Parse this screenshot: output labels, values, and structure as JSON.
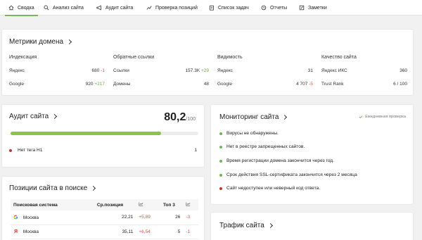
{
  "nav": {
    "tabs": [
      {
        "label": "Сводка",
        "icon": "home-icon",
        "active": true
      },
      {
        "label": "Анализ сайта",
        "icon": "search-icon"
      },
      {
        "label": "Аудит сайта",
        "icon": "megaphone-icon"
      },
      {
        "label": "Проверка позиций",
        "icon": "trend-icon"
      },
      {
        "label": "Список задач",
        "icon": "clipboard-icon"
      },
      {
        "label": "Отчеты",
        "icon": "clock-icon"
      },
      {
        "label": "Заметки",
        "icon": "edit-icon"
      }
    ]
  },
  "metrics": {
    "title": "Метрики домена",
    "columns": [
      {
        "head": "Индексация",
        "rows": [
          {
            "label": "Яндекс",
            "value": "680",
            "delta": "-1",
            "trend": "neg"
          },
          {
            "label": "Google",
            "value": "920",
            "delta": "+217",
            "trend": "pos"
          }
        ]
      },
      {
        "head": "Обратные ссылки",
        "rows": [
          {
            "label": "Ссылки",
            "value": "157.3K",
            "delta": "+29",
            "trend": "pos"
          },
          {
            "label": "Домены",
            "value": "48",
            "delta": "",
            "trend": ""
          }
        ]
      },
      {
        "head": "Видимость",
        "rows": [
          {
            "label": "Яндекс",
            "value": "31",
            "delta": "",
            "trend": ""
          },
          {
            "label": "Google",
            "value": "4 707",
            "delta": "-5",
            "trend": "neg"
          }
        ]
      },
      {
        "head": "Качество сайта",
        "rows": [
          {
            "label": "Яндекс ИКС",
            "value": "360",
            "delta": "",
            "trend": ""
          },
          {
            "label": "Trust Rank",
            "value": "6 / 100",
            "delta": "",
            "trend": ""
          }
        ]
      }
    ]
  },
  "audit": {
    "title": "Аудит сайта",
    "score": "80,2",
    "score_max": "/100",
    "progress": 0.8,
    "issues": [
      {
        "label": "Нет тега H1",
        "count": "1"
      }
    ]
  },
  "monitoring": {
    "title": "Мониторинг сайта",
    "badge": "Ежедневная проверка",
    "items": [
      "Вирусы не обнаружены.",
      "Нет в реестре запрещенных сайтов.",
      "Время регистрации домена закончится через год.",
      "Срок действия SSL-сертификата закончится через 2 месяца",
      "Сайт недоступен или неверный код ответа."
    ]
  },
  "positions": {
    "title": "Позиции сайта в поиске",
    "headers": {
      "engine": "Поисковая система",
      "avg": "Ср.позиция",
      "top": "Топ 3"
    },
    "rows": [
      {
        "engine": "google",
        "region": "Москва",
        "avg": "22,21",
        "avg_delta": "+5,89",
        "top": "26",
        "top_delta": "-3"
      },
      {
        "engine": "yandex",
        "region": "Москва",
        "avg": "35,11",
        "avg_delta": "+6,54",
        "top": "5",
        "top_delta": "-1"
      }
    ]
  },
  "traffic": {
    "title": "Трафик сайта"
  },
  "colors": {
    "accent": "#7ab35d",
    "positive": "#6fae4a",
    "negative": "#d9534f"
  }
}
